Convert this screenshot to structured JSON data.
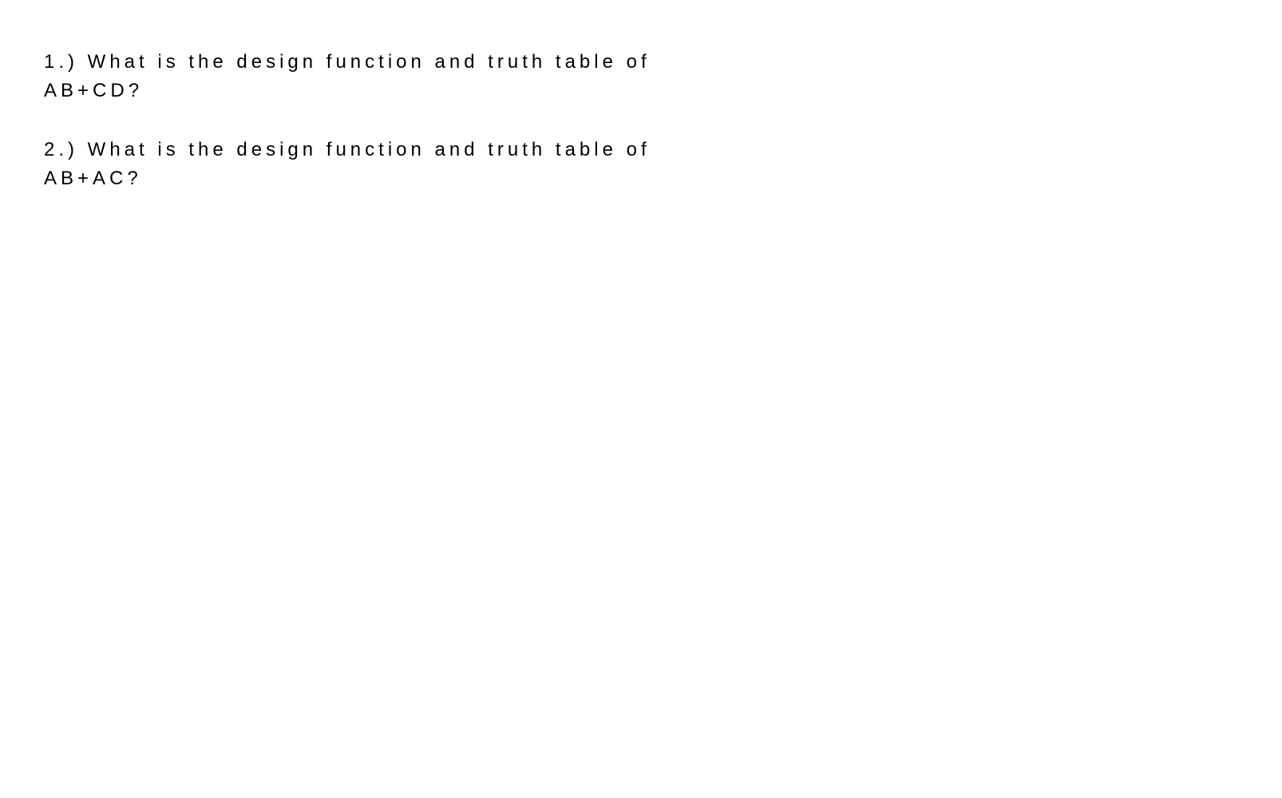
{
  "questions": [
    {
      "text": "1.) What is the design function and truth table of AB+CD?"
    },
    {
      "text": "2.) What is the design function and truth table of AB+AC?"
    }
  ]
}
